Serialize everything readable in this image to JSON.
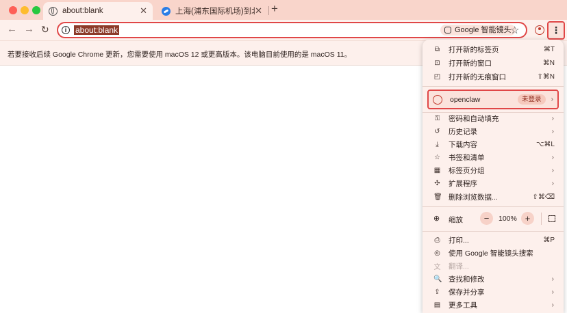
{
  "tabs": [
    {
      "title": "about:blank",
      "active": true
    },
    {
      "title": "上海(浦东国际机场)到北京(大兴",
      "active": false
    }
  ],
  "toolbar": {
    "url": "about:blank",
    "lens_chip": "Google 智能镜头",
    "menu_glyph": "⋮"
  },
  "infobar": {
    "message": "若要接收后续 Google Chrome 更新，您需要使用 macOS 12 或更高版本。该电脑目前使用的是 macOS 11。"
  },
  "menu": {
    "group1": [
      {
        "label": "打开新的标签页",
        "shortcut": "⌘T",
        "icon": "new-tab-icon"
      },
      {
        "label": "打开新的窗口",
        "shortcut": "⌘N",
        "icon": "new-window-icon"
      },
      {
        "label": "打开新的无痕窗口",
        "shortcut": "⇧⌘N",
        "icon": "incognito-icon"
      }
    ],
    "profile": {
      "name": "openclaw",
      "status": "未登录"
    },
    "group2": [
      {
        "label": "密码和自动填充",
        "shortcut": "",
        "icon": "key-icon",
        "submenu": true
      },
      {
        "label": "历史记录",
        "shortcut": "",
        "icon": "history-icon",
        "submenu": true
      },
      {
        "label": "下载内容",
        "shortcut": "⌥⌘L",
        "icon": "download-icon",
        "submenu": false
      },
      {
        "label": "书签和清单",
        "shortcut": "",
        "icon": "star-icon",
        "submenu": true
      },
      {
        "label": "标签页分组",
        "shortcut": "",
        "icon": "grid-icon",
        "submenu": true
      },
      {
        "label": "扩展程序",
        "shortcut": "",
        "icon": "puzzle-icon",
        "submenu": true
      },
      {
        "label": "删除浏览数据...",
        "shortcut": "⇧⌘⌫",
        "icon": "trash-icon",
        "submenu": false
      }
    ],
    "zoom": {
      "label": "缩放",
      "minus": "−",
      "value": "100%",
      "plus": "+"
    },
    "group3": [
      {
        "label": "打印...",
        "shortcut": "⌘P",
        "icon": "print-icon",
        "submenu": false,
        "disabled": false
      },
      {
        "label": "使用 Google 智能镜头搜索",
        "shortcut": "",
        "icon": "lens-icon",
        "submenu": false,
        "disabled": false
      },
      {
        "label": "翻译...",
        "shortcut": "",
        "icon": "translate-icon",
        "submenu": false,
        "disabled": true
      },
      {
        "label": "查找和修改",
        "shortcut": "",
        "icon": "find-icon",
        "submenu": true,
        "disabled": false
      },
      {
        "label": "保存并分享",
        "shortcut": "",
        "icon": "share-icon",
        "submenu": true,
        "disabled": false
      },
      {
        "label": "更多工具",
        "shortcut": "",
        "icon": "toolbox-icon",
        "submenu": true,
        "disabled": false
      }
    ]
  }
}
